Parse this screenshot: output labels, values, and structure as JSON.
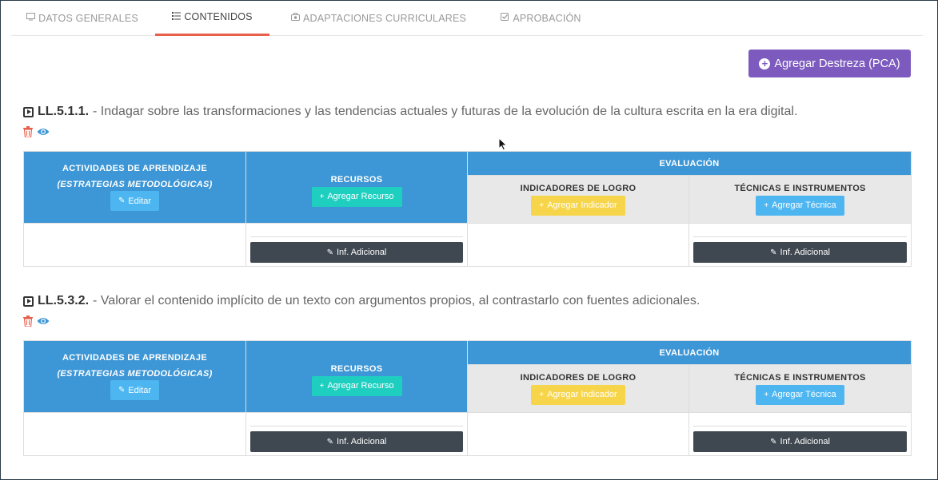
{
  "tabs": [
    {
      "label": "DATOS GENERALES",
      "icon": "monitor-icon"
    },
    {
      "label": "CONTENIDOS",
      "icon": "list-icon",
      "active": true
    },
    {
      "label": "ADAPTACIONES CURRICULARES",
      "icon": "wheelchair-icon"
    },
    {
      "label": "APROBACIÓN",
      "icon": "check-square-icon"
    }
  ],
  "add_button": {
    "label": "Agregar Destreza (PCA)",
    "icon": "plus-circle-icon"
  },
  "table_headers": {
    "actividades": "ACTIVIDADES DE APRENDIZAJE",
    "estrategias": "(ESTRATEGIAS METODOLÓGICAS)",
    "recursos": "RECURSOS",
    "evaluacion": "EVALUACIÓN",
    "indicadores": "INDICADORES DE LOGRO",
    "tecnicas": "TÉCNICAS E INSTRUMENTOS",
    "editar": "Editar",
    "agregar_recurso": "Agregar Recurso",
    "agregar_indicador": "Agregar Indicador",
    "agregar_tecnica": "Agregar Técnica",
    "inf_adicional": "Inf. Adicional"
  },
  "skills": [
    {
      "code": "LL.5.1.1.",
      "description": "- Indagar sobre las transformaciones y las tendencias actuales y futuras de la evolución de la cultura escrita en la era digital."
    },
    {
      "code": "LL.5.3.2.",
      "description": "- Valorar el contenido implícito de un texto con argumentos propios, al contrastarlo con fuentes adicionales."
    }
  ],
  "colors": {
    "accent_tab": "#e8604c",
    "purple": "#7d5bbe",
    "header_blue": "#3d96d5",
    "teal": "#1ecfc0",
    "yellow": "#f7d54a",
    "sky": "#4db6f1",
    "dark": "#3f4850"
  }
}
